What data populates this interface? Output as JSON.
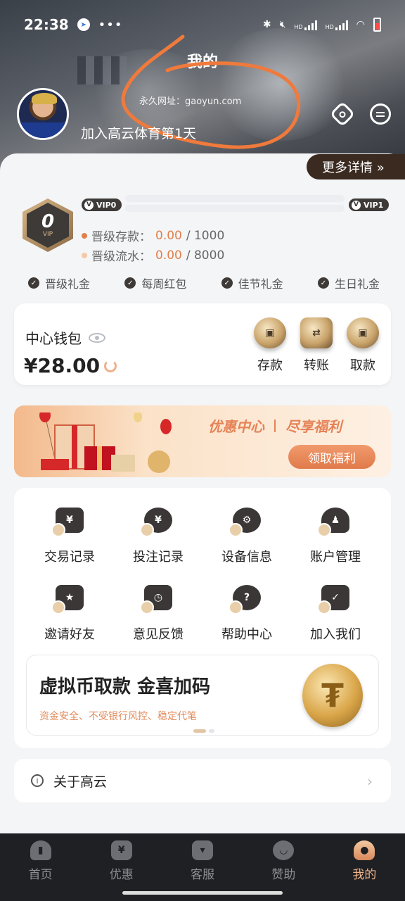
{
  "status": {
    "time": "22:38",
    "dots": "•••",
    "hd1": "HD",
    "hd2": "HD"
  },
  "header": {
    "title": "我的",
    "url_note": "永久网址：gaoyun.com",
    "join_text": "加入高云体育第1天",
    "more_detail": "更多详情 »"
  },
  "vip": {
    "current_level": "0",
    "badge_label": "VIP",
    "tag_current": "VIP0",
    "tag_next": "VIP1",
    "deposit_label": "晋级存款：",
    "deposit_current": "0.00",
    "deposit_target": " / 1000",
    "turnover_label": "晋级流水：",
    "turnover_current": "0.00",
    "turnover_target": " / 8000",
    "deposit_progress": 0,
    "turnover_progress": 0,
    "benefits": [
      "晋级礼金",
      "每周红包",
      "佳节礼金",
      "生日礼金"
    ]
  },
  "wallet": {
    "title": "中心钱包",
    "amount": "¥28.00",
    "actions": [
      "存款",
      "转账",
      "取款"
    ]
  },
  "banner": {
    "slogan_left": "优惠中心",
    "slogan_right": "尽享福利",
    "button": "领取福利"
  },
  "menu": {
    "items": [
      "交易记录",
      "投注记录",
      "设备信息",
      "账户管理",
      "邀请好友",
      "意见反馈",
      "帮助中心",
      "加入我们"
    ]
  },
  "promo": {
    "title": "虚拟币取款  金喜加码",
    "subtitle": "资金安全、不受银行风控、稳定代笔"
  },
  "about": {
    "label": "关于高云"
  },
  "tabbar": {
    "items": [
      "首页",
      "优惠",
      "客服",
      "赞助",
      "我的"
    ],
    "active_index": 4
  },
  "colors": {
    "accent": "#e07f4a",
    "dark": "#3d3a38",
    "tab_active": "#f0b48a"
  }
}
